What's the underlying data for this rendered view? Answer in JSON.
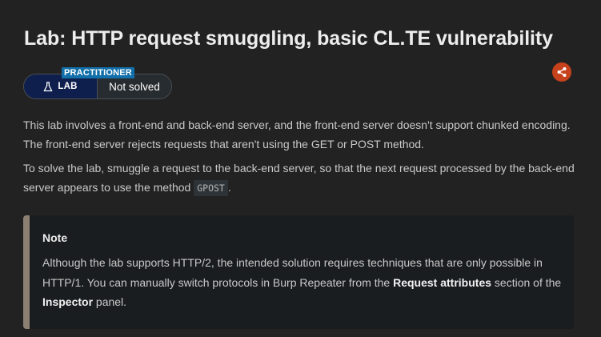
{
  "header": {
    "title": "Lab: HTTP request smuggling, basic CL.TE vulnerability"
  },
  "badge": {
    "level": "PRACTITIONER",
    "lab_label": "LAB",
    "status": "Not solved",
    "lab_icon": "flask-icon"
  },
  "share": {
    "icon": "share-icon",
    "color": "#c7411c"
  },
  "description": {
    "paragraph1": "This lab involves a front-end and back-end server, and the front-end server doesn't support chunked encoding. The front-end server rejects requests that aren't using the GET or POST method.",
    "paragraph2_before": "To solve the lab, smuggle a request to the back-end server, so that the next request processed by the back-end server appears to use the method ",
    "paragraph2_code": "GPOST",
    "paragraph2_after": "."
  },
  "note": {
    "title": "Note",
    "text1": "Although the lab supports HTTP/2, the intended solution requires techniques that are only possible in HTTP/1. You can manually switch protocols in Burp Repeater from the ",
    "bold1": "Request attributes",
    "text2": " section of the ",
    "bold2": "Inspector",
    "text3": " panel."
  },
  "colors": {
    "background": "#222222",
    "lab_badge": "#0e1f4d",
    "level_tag": "#116fa9",
    "note_border": "#8c8073"
  }
}
